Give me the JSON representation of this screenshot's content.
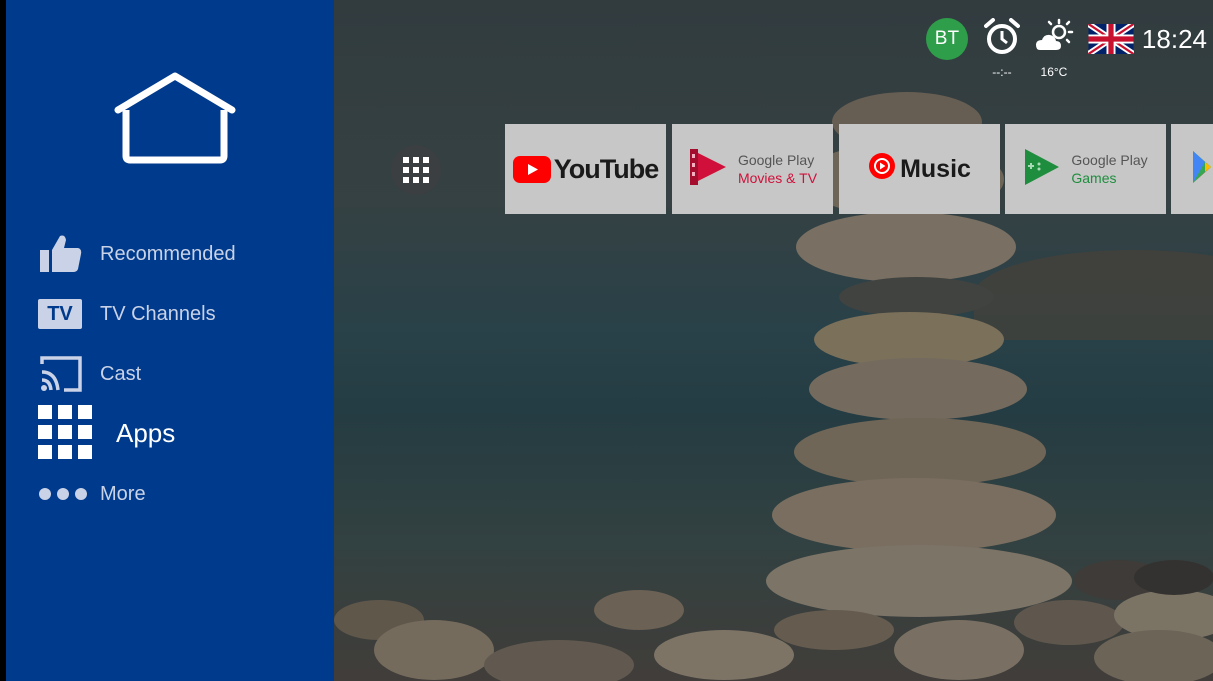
{
  "sidebar": {
    "items": [
      {
        "label": "Recommended",
        "icon": "thumbs-up-icon"
      },
      {
        "label": "TV Channels",
        "icon": "tv-icon",
        "icon_text": "TV"
      },
      {
        "label": "Cast",
        "icon": "cast-icon"
      },
      {
        "label": "Apps",
        "icon": "apps-grid-icon",
        "active": true
      },
      {
        "label": "More",
        "icon": "more-dots-icon"
      }
    ],
    "home_icon": "home-icon",
    "color": "#003a8c"
  },
  "status": {
    "avatar": "BT",
    "alarm": "--:--",
    "temperature": "16°C",
    "language_flag": "uk-flag-icon",
    "time": "18:24"
  },
  "apps_row": [
    {
      "name": "YouTube",
      "text": "YouTube"
    },
    {
      "name": "Google Play Movies & TV",
      "line1": "Google Play",
      "line2": "Movies & TV"
    },
    {
      "name": "Music",
      "text": "Music"
    },
    {
      "name": "Google Play Games",
      "line1": "Google Play",
      "line2": "Games"
    },
    {
      "name": "Google Play Store"
    }
  ],
  "colors": {
    "youtube_red": "#ff0000",
    "movies_red": "#d0103a",
    "games_green": "#1e8e3e",
    "avatar_green": "#2e9e4a"
  }
}
